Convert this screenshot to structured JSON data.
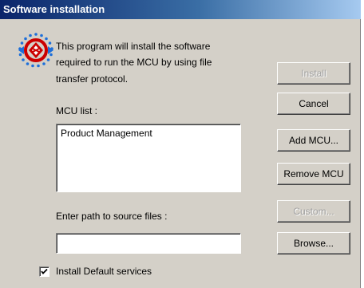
{
  "window": {
    "title": "Software installation"
  },
  "info": {
    "line1": "This program will install the software",
    "line2": "required to run the MCU by using file",
    "line3": "transfer protocol."
  },
  "mcu_list": {
    "label": "MCU list :",
    "items": [
      "Product Management"
    ]
  },
  "path": {
    "label": "Enter path to source files :",
    "value": ""
  },
  "buttons": {
    "install": "Install",
    "cancel": "Cancel",
    "add_mcu": "Add MCU...",
    "remove_mcu": "Remove MCU",
    "custom": "Custom...",
    "browse": "Browse..."
  },
  "default_services": {
    "label": "Install Default services",
    "checked": true
  },
  "colors": {
    "title_bar_start": "#0a246a",
    "title_bar_end": "#a6caf0",
    "dialog_face": "#d4d0c8",
    "icon_red": "#cc0000",
    "icon_blue": "#1e6fd9"
  },
  "icons": {
    "app_icon": "mcu-network-icon",
    "checkbox_mark": "checkmark-icon"
  }
}
